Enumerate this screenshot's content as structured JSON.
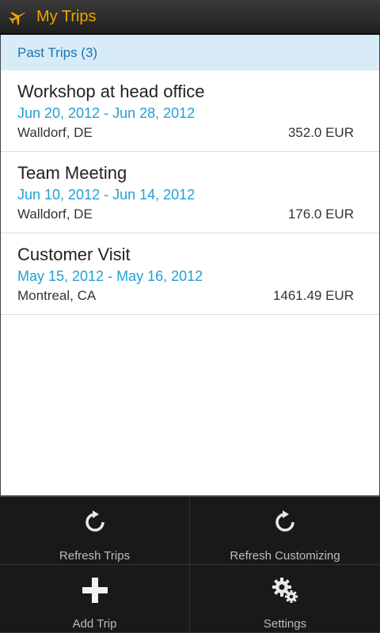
{
  "action_bar": {
    "title": "My Trips",
    "icon": "airplane-icon",
    "title_color": "#f0a500"
  },
  "section": {
    "header": "Past Trips (3)"
  },
  "trips": [
    {
      "title": "Workshop at head office",
      "dates": "Jun 20, 2012 - Jun 28, 2012",
      "location": "Walldorf, DE",
      "amount": "352.0 EUR"
    },
    {
      "title": "Team Meeting",
      "dates": "Jun 10, 2012 - Jun 14, 2012",
      "location": "Walldorf, DE",
      "amount": "176.0 EUR"
    },
    {
      "title": "Customer Visit",
      "dates": "May 15, 2012 - May 16, 2012",
      "location": "Montreal, CA",
      "amount": "1461.49 EUR"
    }
  ],
  "menu": {
    "items": [
      {
        "label": "Refresh Trips",
        "icon": "refresh-icon"
      },
      {
        "label": "Refresh Customizing",
        "icon": "refresh-icon"
      },
      {
        "label": "Add Trip",
        "icon": "plus-icon"
      },
      {
        "label": "Settings",
        "icon": "gear-icon"
      }
    ]
  },
  "colors": {
    "date_color": "#21a0d6",
    "section_bg": "#d8ecf7",
    "section_text": "#1774b3"
  }
}
